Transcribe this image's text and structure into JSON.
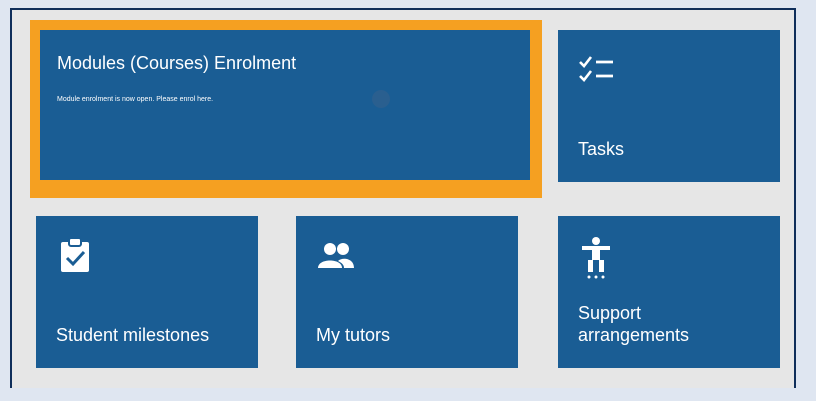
{
  "tiles": {
    "featured": {
      "title": "Modules (Courses) Enrolment",
      "subtitle": "Module enrolment is now open. Please enrol here.",
      "icon": "none"
    },
    "tasks": {
      "label": "Tasks",
      "icon": "checklist-icon"
    },
    "student_milestones": {
      "label": "Student milestones",
      "icon": "clipboard-check-icon"
    },
    "my_tutors": {
      "label": "My tutors",
      "icon": "people-icon"
    },
    "support_arrangements": {
      "label": "Support arrangements",
      "icon": "accessibility-icon"
    }
  },
  "colors": {
    "tile_blue": "#1a5d94",
    "highlight_orange": "#f5a021",
    "frame_navy": "#0f2e5a",
    "panel_grey": "#e6e6e6"
  }
}
